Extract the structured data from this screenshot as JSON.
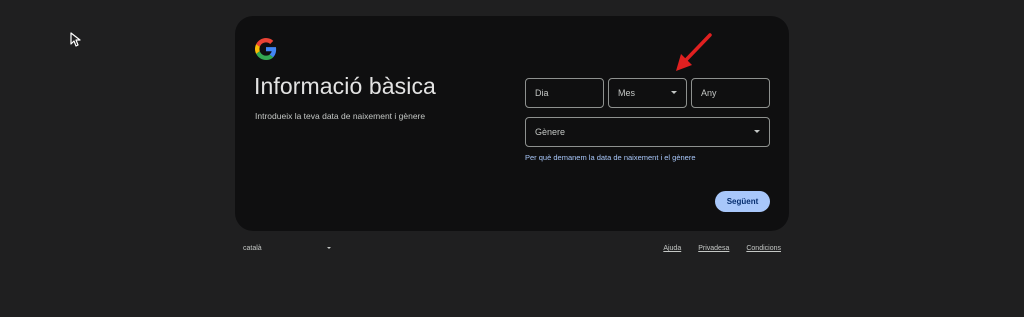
{
  "card": {
    "title": "Informació bàsica",
    "subtitle": "Introdueix la teva data de naixement i gènere",
    "fields": {
      "day_placeholder": "Dia",
      "month_placeholder": "Mes",
      "year_placeholder": "Any",
      "gender_placeholder": "Gènere"
    },
    "why_link": "Per què demanem la data de naixement i el gènere",
    "next_button": "Següent"
  },
  "footer": {
    "language": "català",
    "links": [
      "Ajuda",
      "Privadesa",
      "Condicions"
    ]
  },
  "colors": {
    "background": "#1f1f20",
    "card": "#0f0f10",
    "accent": "#a8c7fa",
    "arrow": "#e02020"
  },
  "icons": [
    "google-logo-icon",
    "cursor-icon",
    "chevron-down-icon",
    "red-arrow-annotation-icon"
  ]
}
